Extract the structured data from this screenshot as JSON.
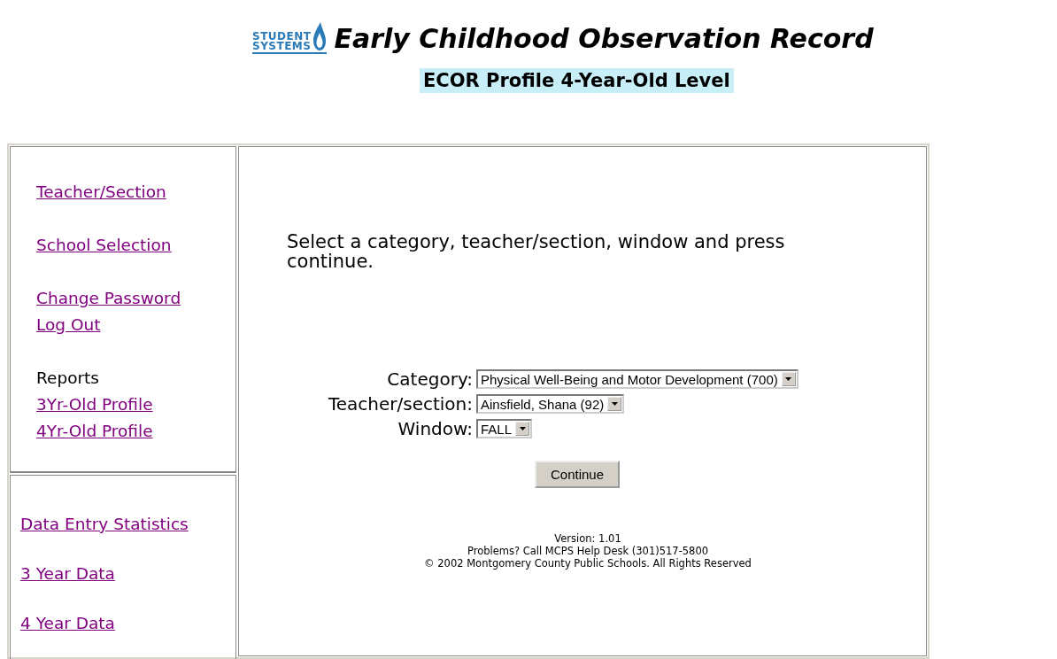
{
  "header": {
    "logo_lines": [
      "STUDENT",
      "SYSTEMS"
    ],
    "title": "Early Childhood Observation Record",
    "subtitle": "ECOR Profile 4-Year-Old Level"
  },
  "sidebar": {
    "top_groups": [
      [
        {
          "kind": "link",
          "label": "Teacher/Section"
        }
      ],
      [
        {
          "kind": "link",
          "label": "School Selection"
        }
      ],
      [
        {
          "kind": "link",
          "label": "Change Password"
        },
        {
          "kind": "link",
          "label": "Log Out"
        }
      ],
      [
        {
          "kind": "label",
          "label": "Reports"
        },
        {
          "kind": "link",
          "label": "3Yr-Old Profile"
        },
        {
          "kind": "link",
          "label": "4Yr-Old Profile"
        }
      ]
    ],
    "bottom_items": [
      {
        "kind": "link",
        "label": "Data Entry Statistics"
      },
      {
        "kind": "link",
        "label": "3 Year Data"
      },
      {
        "kind": "link",
        "label": "4 Year Data"
      }
    ]
  },
  "main": {
    "instruction": "Select a category, teacher/section, window and press continue.",
    "fields": [
      {
        "label": "Category:",
        "value": "Physical Well-Being and Motor Development (700)"
      },
      {
        "label": "Teacher/section:",
        "value": "Ainsfield, Shana (92)"
      },
      {
        "label": "Window:",
        "value": "FALL"
      }
    ],
    "button": "Continue",
    "footer": [
      "Version: 1.01",
      "Problems? Call MCPS Help Desk (301)517-5800",
      "© 2002 Montgomery County Public Schools. All Rights Reserved"
    ]
  }
}
